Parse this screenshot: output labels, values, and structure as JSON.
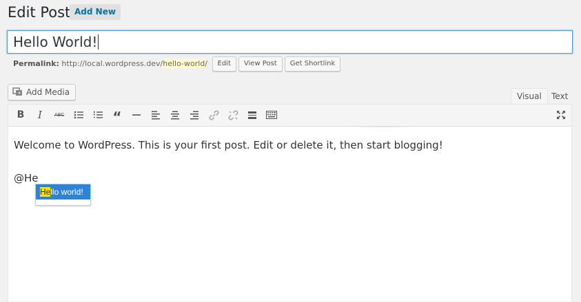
{
  "header": {
    "title": "Edit Post",
    "add_new_label": "Add New"
  },
  "post": {
    "title": "Hello World!"
  },
  "permalink": {
    "label": "Permalink:",
    "base_url": "http://local.wordpress.dev/",
    "slug": "hello-world",
    "trailing": "/",
    "buttons": {
      "edit": "Edit",
      "view_post": "View Post",
      "get_shortlink": "Get Shortlink"
    }
  },
  "media": {
    "add_media_label": "Add Media"
  },
  "editor_tabs": {
    "visual": "Visual",
    "text": "Text",
    "active": "Visual"
  },
  "toolbar": {
    "bold_label": "B",
    "italic_label": "I",
    "strikethrough_label": "ABC",
    "blockquote_label": "“",
    "icons": [
      "bold-icon",
      "italic-icon",
      "strikethrough-icon",
      "bulleted-list-icon",
      "numbered-list-icon",
      "blockquote-icon",
      "horizontal-line-icon",
      "align-left-icon",
      "align-center-icon",
      "align-right-icon",
      "insert-link-icon",
      "remove-link-icon",
      "read-more-icon",
      "toolbar-toggle-icon",
      "fullscreen-icon"
    ]
  },
  "content": {
    "paragraph": "Welcome to WordPress. This is your first post. Edit or delete it, then start blogging!",
    "mention_text": "@He"
  },
  "autocomplete": {
    "match": "He",
    "rest": "llo world!"
  },
  "colors": {
    "accent": "#0073aa",
    "focus_border": "#5b9dd9",
    "autocomplete_selected": "#3083d4",
    "highlight": "#f2e600"
  }
}
